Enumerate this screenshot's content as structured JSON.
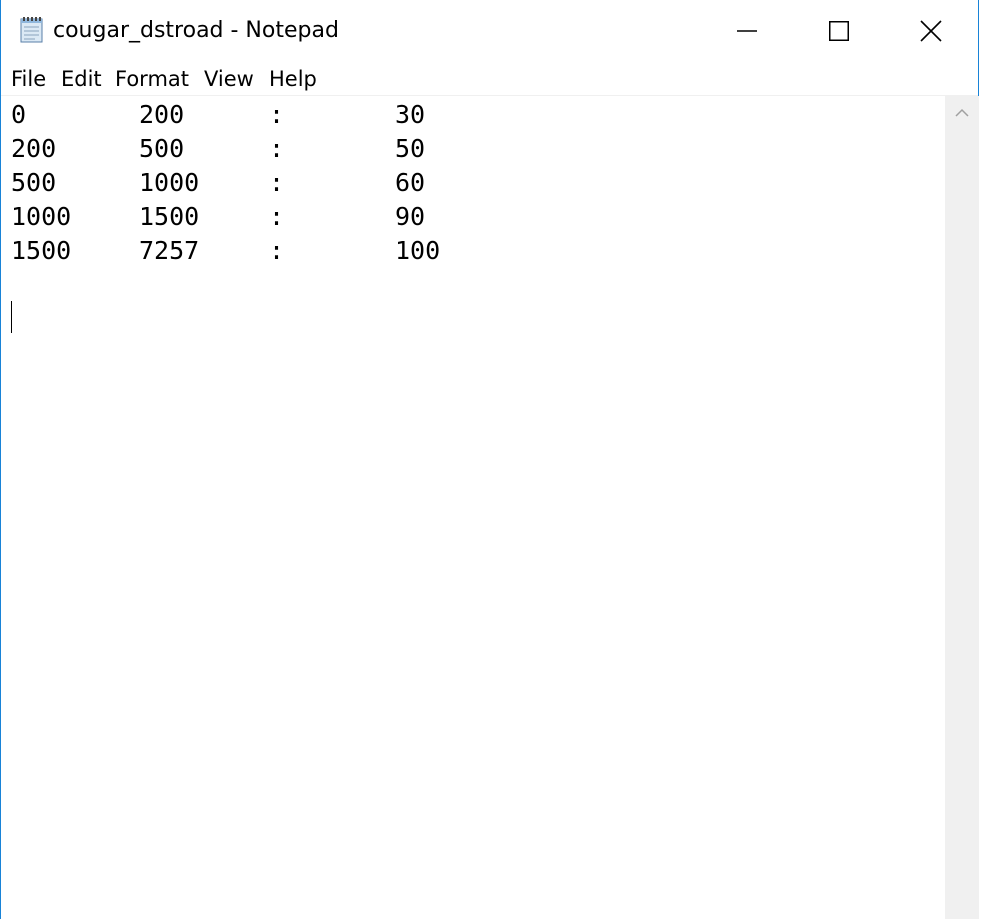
{
  "window": {
    "title": "cougar_dstroad - Notepad",
    "app_icon": "notepad-icon",
    "controls": {
      "minimize_icon": "minimize-icon",
      "maximize_icon": "maximize-icon",
      "close_icon": "close-icon"
    }
  },
  "menu": {
    "items": [
      "File",
      "Edit",
      "Format",
      "View",
      "Help"
    ]
  },
  "editor": {
    "lines": [
      [
        "0",
        "200",
        ":",
        "30"
      ],
      [
        "200",
        "500",
        ":",
        "50"
      ],
      [
        "500",
        "1000",
        ":",
        "60"
      ],
      [
        "1000",
        "1500",
        ":",
        "90"
      ],
      [
        "1500",
        "7257",
        ":",
        "100"
      ]
    ]
  },
  "scrollbar": {
    "up_icon": "chevron-up-icon"
  },
  "colors": {
    "border": "#1883d7",
    "scrollbar_track": "#f0f0f0"
  }
}
